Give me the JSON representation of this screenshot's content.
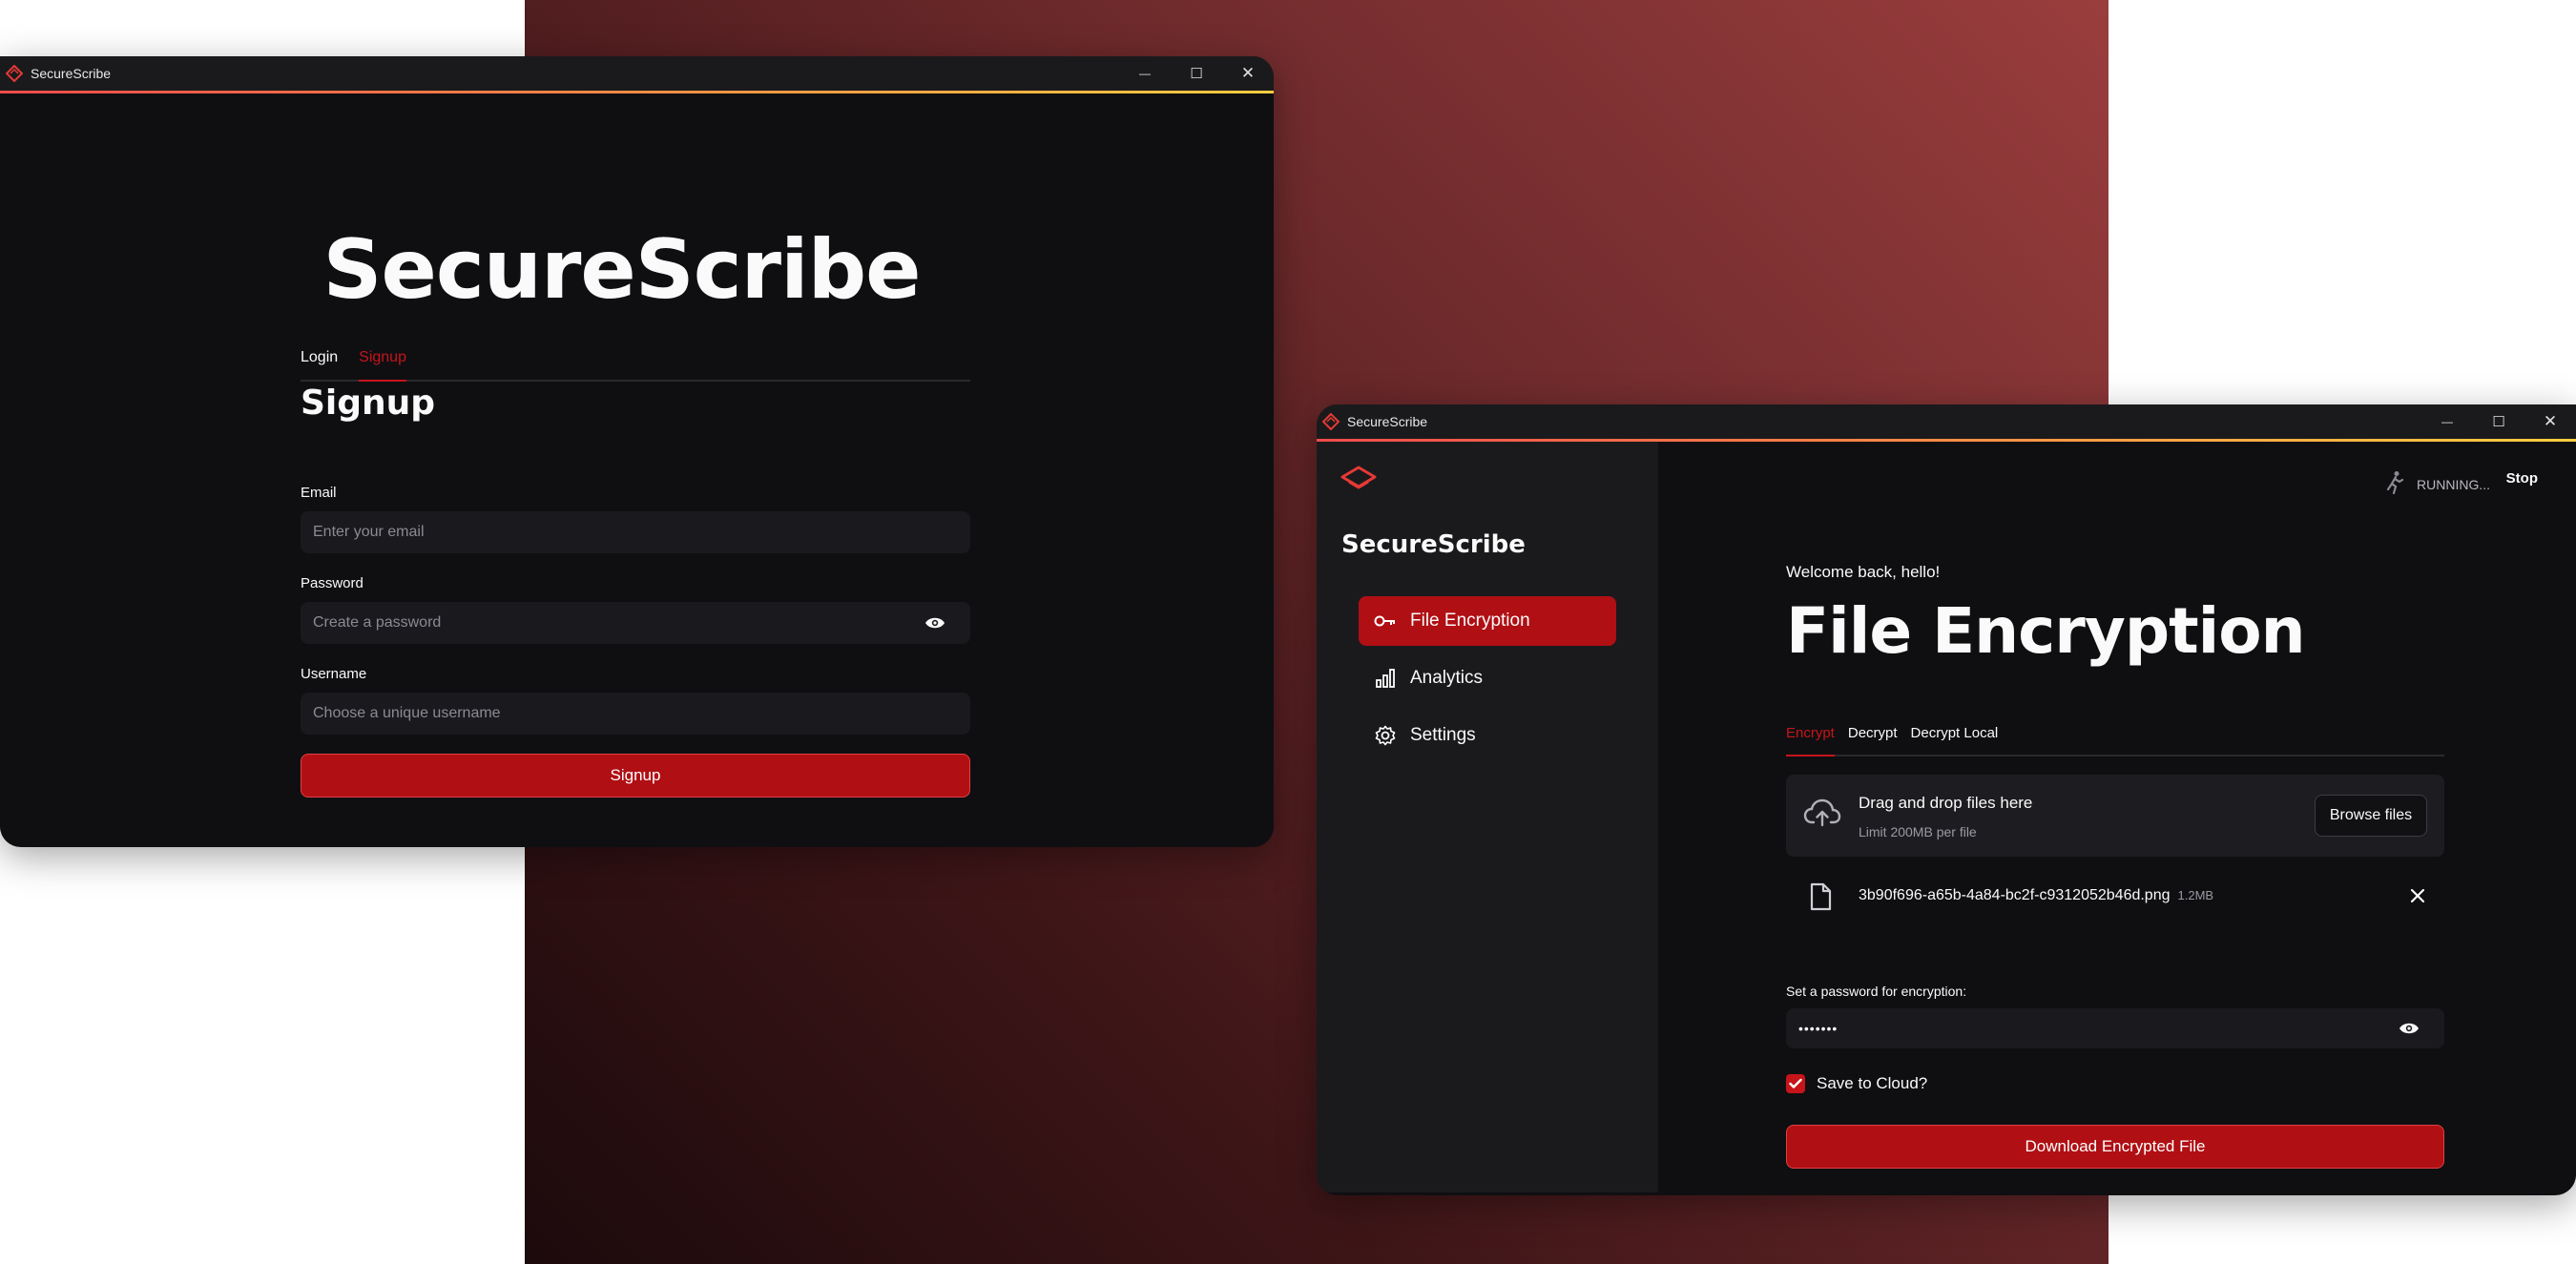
{
  "app": {
    "title": "SecureScribe",
    "accent": "#b00f14",
    "titlebar_gradient": [
      "#ef4b4b",
      "#ffcd40"
    ]
  },
  "window_controls": {
    "minimize": "—",
    "maximize": "☐",
    "close": "✕"
  },
  "login_window": {
    "brand": "SecureScribe",
    "tabs": [
      {
        "label": "Login",
        "active": false
      },
      {
        "label": "Signup",
        "active": true
      }
    ],
    "heading": "Signup",
    "email": {
      "label": "Email",
      "placeholder": "Enter your email"
    },
    "password": {
      "label": "Password",
      "placeholder": "Create a password",
      "icon": "eye-icon"
    },
    "username": {
      "label": "Username",
      "placeholder": "Choose a unique username"
    },
    "submit_label": "Signup"
  },
  "app_window": {
    "sidebar": {
      "brand": "SecureScribe",
      "items": [
        {
          "label": "File Encryption",
          "icon": "key-icon",
          "active": true
        },
        {
          "label": "Analytics",
          "icon": "bar-chart-icon",
          "active": false
        },
        {
          "label": "Settings",
          "icon": "gear-icon",
          "active": false
        }
      ]
    },
    "status": {
      "running": "RUNNING...",
      "stop": "Stop"
    },
    "welcome": "Welcome back, hello!",
    "page_title": "File Encryption",
    "tabs": [
      {
        "label": "Encrypt",
        "active": true
      },
      {
        "label": "Decrypt",
        "active": false
      },
      {
        "label": "Decrypt Local",
        "active": false
      }
    ],
    "uploader": {
      "title": "Drag and drop files here",
      "subtitle": "Limit 200MB per file",
      "browse_label": "Browse files"
    },
    "file": {
      "name": "3b90f696-a65b-4a84-bc2f-c9312052b46d.png",
      "size": "1.2MB"
    },
    "password": {
      "label": "Set a password for encryption:",
      "value": "•••••••"
    },
    "save_to_cloud": {
      "label": "Save to Cloud?",
      "checked": true
    },
    "download_label": "Download Encrypted File"
  }
}
